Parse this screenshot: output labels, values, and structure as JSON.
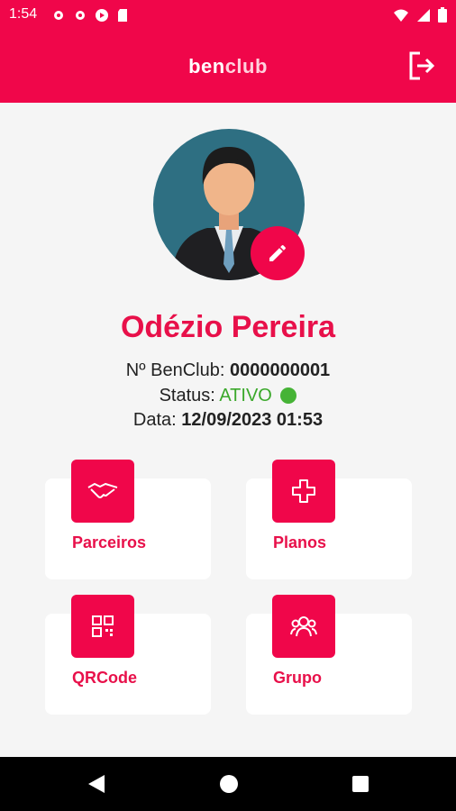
{
  "status_bar": {
    "time": "1:54"
  },
  "app_bar": {
    "brand_ben": "ben",
    "brand_club": "club"
  },
  "profile": {
    "name": "Odézio Pereira",
    "benclub_label": "Nº BenClub:",
    "benclub_number": "0000000001",
    "status_label": "Status:",
    "status_value": "ATIVO",
    "date_label": "Data:",
    "date_value": "12/09/2023 01:53"
  },
  "menu": [
    {
      "label": "Parceiros",
      "icon": "handshake-icon"
    },
    {
      "label": "Planos",
      "icon": "plus-icon"
    },
    {
      "label": "QRCode",
      "icon": "qrcode-icon"
    },
    {
      "label": "Grupo",
      "icon": "group-icon"
    }
  ],
  "colors": {
    "primary": "#f0064a",
    "active": "#3aa82a",
    "avatar_bg": "#2e6f82"
  }
}
